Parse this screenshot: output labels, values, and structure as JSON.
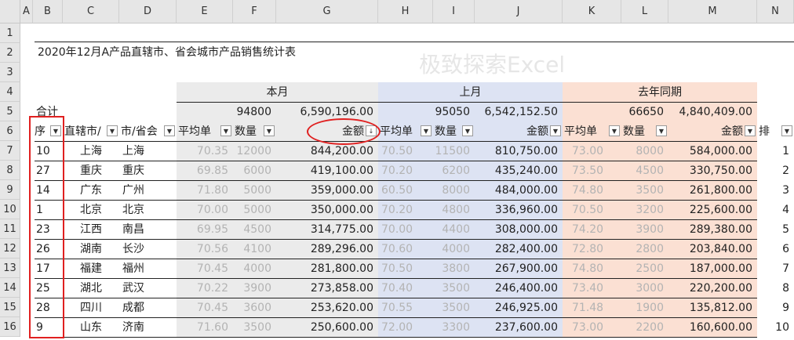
{
  "columns": [
    "A",
    "B",
    "C",
    "D",
    "E",
    "F",
    "G",
    "H",
    "I",
    "J",
    "K",
    "L",
    "M",
    "N"
  ],
  "rows": [
    "1",
    "2",
    "3",
    "4",
    "5",
    "6",
    "7",
    "8",
    "9",
    "10",
    "11",
    "12",
    "13",
    "14",
    "15",
    "16"
  ],
  "title": "2020年12月A产品直辖市、省会城市产品销售统计表",
  "watermark": "极致探索Excel",
  "groups": {
    "current": "本月",
    "last_month": "上月",
    "last_year": "去年同期"
  },
  "totals_label": "合计",
  "totals": {
    "current_qty": "94800",
    "current_amount": "6,590,196.00",
    "last_qty": "95050",
    "last_amount": "6,542,152.50",
    "prev_qty": "66650",
    "prev_amount": "4,840,409.00"
  },
  "headers": {
    "seq": "序",
    "city_direct": "直辖市/",
    "city_province": "市/省会",
    "avg_price": "平均单",
    "qty": "数量",
    "amount": "金额",
    "rank": "排"
  },
  "dropdown_glyph": "▼",
  "sort_glyph": "↓",
  "table_rows": [
    {
      "seq": "10",
      "region": "上海",
      "city": "上海",
      "c_avg": "70.35",
      "c_qty": "12000",
      "c_amt": "844,200.00",
      "l_avg": "70.50",
      "l_qty": "11500",
      "l_amt": "810,750.00",
      "p_avg": "73.00",
      "p_qty": "8000",
      "p_amt": "584,000.00",
      "rank": "1"
    },
    {
      "seq": "27",
      "region": "重庆",
      "city": "重庆",
      "c_avg": "69.85",
      "c_qty": "6000",
      "c_amt": "419,100.00",
      "l_avg": "70.20",
      "l_qty": "6200",
      "l_amt": "435,240.00",
      "p_avg": "73.50",
      "p_qty": "4500",
      "p_amt": "330,750.00",
      "rank": "2"
    },
    {
      "seq": "14",
      "region": "广东",
      "city": "广州",
      "c_avg": "71.80",
      "c_qty": "5000",
      "c_amt": "359,000.00",
      "l_avg": "60.50",
      "l_qty": "8000",
      "l_amt": "484,000.00",
      "p_avg": "74.80",
      "p_qty": "3500",
      "p_amt": "261,800.00",
      "rank": "3"
    },
    {
      "seq": "1",
      "region": "北京",
      "city": "北京",
      "c_avg": "70.00",
      "c_qty": "5000",
      "c_amt": "350,000.00",
      "l_avg": "70.20",
      "l_qty": "4800",
      "l_amt": "336,960.00",
      "p_avg": "70.50",
      "p_qty": "3200",
      "p_amt": "225,600.00",
      "rank": "4"
    },
    {
      "seq": "23",
      "region": "江西",
      "city": "南昌",
      "c_avg": "69.95",
      "c_qty": "4500",
      "c_amt": "314,775.00",
      "l_avg": "70.00",
      "l_qty": "4400",
      "l_amt": "308,000.00",
      "p_avg": "74.20",
      "p_qty": "3900",
      "p_amt": "289,380.00",
      "rank": "5"
    },
    {
      "seq": "26",
      "region": "湖南",
      "city": "长沙",
      "c_avg": "70.56",
      "c_qty": "4100",
      "c_amt": "289,296.00",
      "l_avg": "70.60",
      "l_qty": "4000",
      "l_amt": "282,400.00",
      "p_avg": "72.80",
      "p_qty": "2800",
      "p_amt": "203,840.00",
      "rank": "6"
    },
    {
      "seq": "17",
      "region": "福建",
      "city": "福州",
      "c_avg": "70.45",
      "c_qty": "4000",
      "c_amt": "281,800.00",
      "l_avg": "70.50",
      "l_qty": "3800",
      "l_amt": "267,900.00",
      "p_avg": "74.80",
      "p_qty": "2500",
      "p_amt": "187,000.00",
      "rank": "7"
    },
    {
      "seq": "25",
      "region": "湖北",
      "city": "武汉",
      "c_avg": "70.22",
      "c_qty": "3900",
      "c_amt": "273,858.00",
      "l_avg": "70.40",
      "l_qty": "3500",
      "l_amt": "246,400.00",
      "p_avg": "73.40",
      "p_qty": "3000",
      "p_amt": "220,200.00",
      "rank": "8"
    },
    {
      "seq": "28",
      "region": "四川",
      "city": "成都",
      "c_avg": "70.45",
      "c_qty": "3600",
      "c_amt": "253,620.00",
      "l_avg": "70.55",
      "l_qty": "3500",
      "l_amt": "246,925.00",
      "p_avg": "71.48",
      "p_qty": "1900",
      "p_amt": "135,812.00",
      "rank": "9"
    },
    {
      "seq": "9",
      "region": "山东",
      "city": "济南",
      "c_avg": "71.60",
      "c_qty": "3500",
      "c_amt": "250,600.00",
      "l_avg": "72.00",
      "l_qty": "3300",
      "l_amt": "237,600.00",
      "p_avg": "73.00",
      "p_qty": "2200",
      "p_amt": "160,600.00",
      "rank": "10"
    }
  ]
}
